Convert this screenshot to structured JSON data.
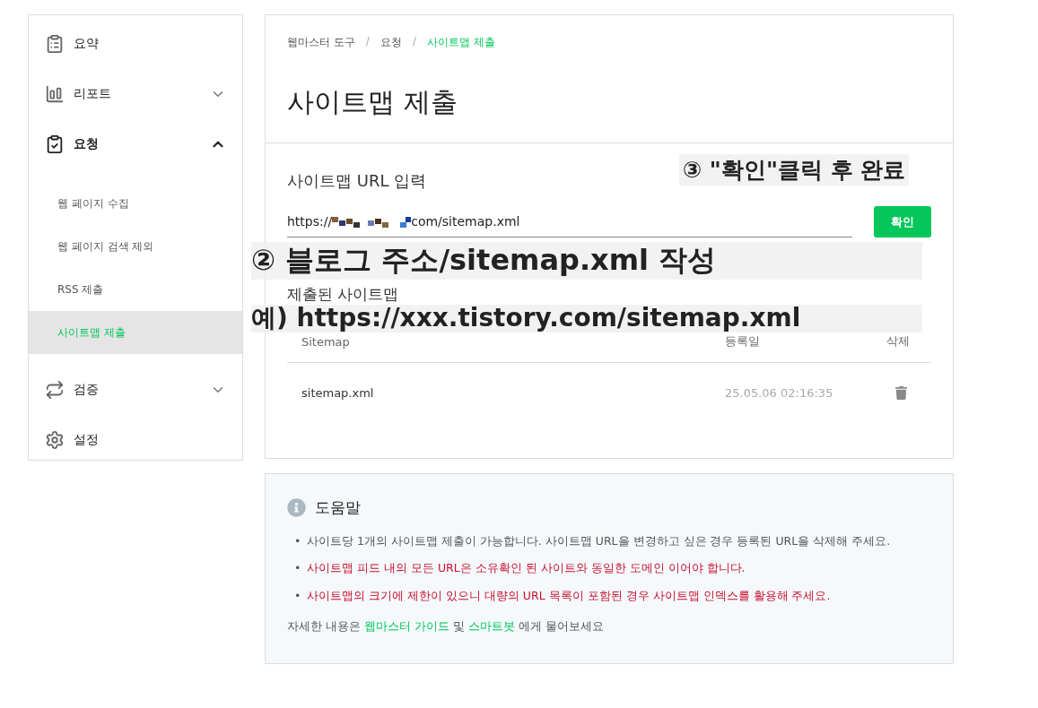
{
  "sidebar": {
    "items": [
      {
        "label": "요약"
      },
      {
        "label": "리포트",
        "expanded": false
      },
      {
        "label": "요청",
        "expanded": true,
        "children": [
          {
            "label": "웹 페이지 수집",
            "selected": false
          },
          {
            "label": "웹 페이지 검색 제외",
            "selected": false
          },
          {
            "label": "RSS 제출",
            "selected": false
          },
          {
            "label": "사이트맵 제출",
            "selected": true
          }
        ]
      },
      {
        "label": "검증",
        "expanded": false
      },
      {
        "label": "설정"
      }
    ]
  },
  "breadcrumb": {
    "separator": "/",
    "items": [
      {
        "label": "웹마스터 도구",
        "selected": false
      },
      {
        "label": "요청",
        "selected": false
      },
      {
        "label": "사이트맵 제출",
        "selected": true
      }
    ]
  },
  "page_title": "사이트맵 제출",
  "url_form": {
    "label": "사이트맵 URL 입력",
    "value_prefix": "https://",
    "value_suffix": "com/sitemap.xml",
    "button": "확인"
  },
  "submitted": {
    "heading": "제출된 사이트맵",
    "columns": [
      "Sitemap",
      "등록일",
      "삭제"
    ],
    "rows": [
      {
        "sitemap": "sitemap.xml",
        "date": "25.05.06 02:16:35"
      }
    ]
  },
  "help": {
    "title": "도움말",
    "bullets": [
      {
        "marker": "•",
        "text": "사이트당 1개의 사이트맵 제출이 가능합니다. 사이트맵 URL을 변경하고 싶은 경우 등록된 URL을 삭제해 주세요.",
        "highlighted": false
      },
      {
        "marker": "•",
        "text": "사이트맵 피드 내의 모든 URL은 소유확인 된 사이트와 동일한 도메인 이어야 합니다.",
        "highlighted": true
      },
      {
        "marker": "•",
        "text": "사이트맵의 크기에 제한이 있으니 대량의 URL 목록이 포함된 경우 사이트맵 인덱스를 활용해 주세요.",
        "highlighted": true
      }
    ],
    "footer": [
      {
        "kind": "text",
        "text": "자세한 내용은 "
      },
      {
        "kind": "link",
        "text": "웹마스터 가이드"
      },
      {
        "kind": "text",
        "text": " 및 "
      },
      {
        "kind": "link",
        "text": "스마트봇"
      },
      {
        "kind": "text",
        "text": " 에게 물어보세요"
      }
    ]
  },
  "annotations": [
    {
      "kind": "step3",
      "text": "③ \"확인\"클릭 후 완료"
    },
    {
      "kind": "step2",
      "text": "② 블로그 주소/sitemap.xml 작성"
    },
    {
      "kind": "example",
      "text": "예) https://xxx.tistory.com/sitemap.xml"
    }
  ]
}
